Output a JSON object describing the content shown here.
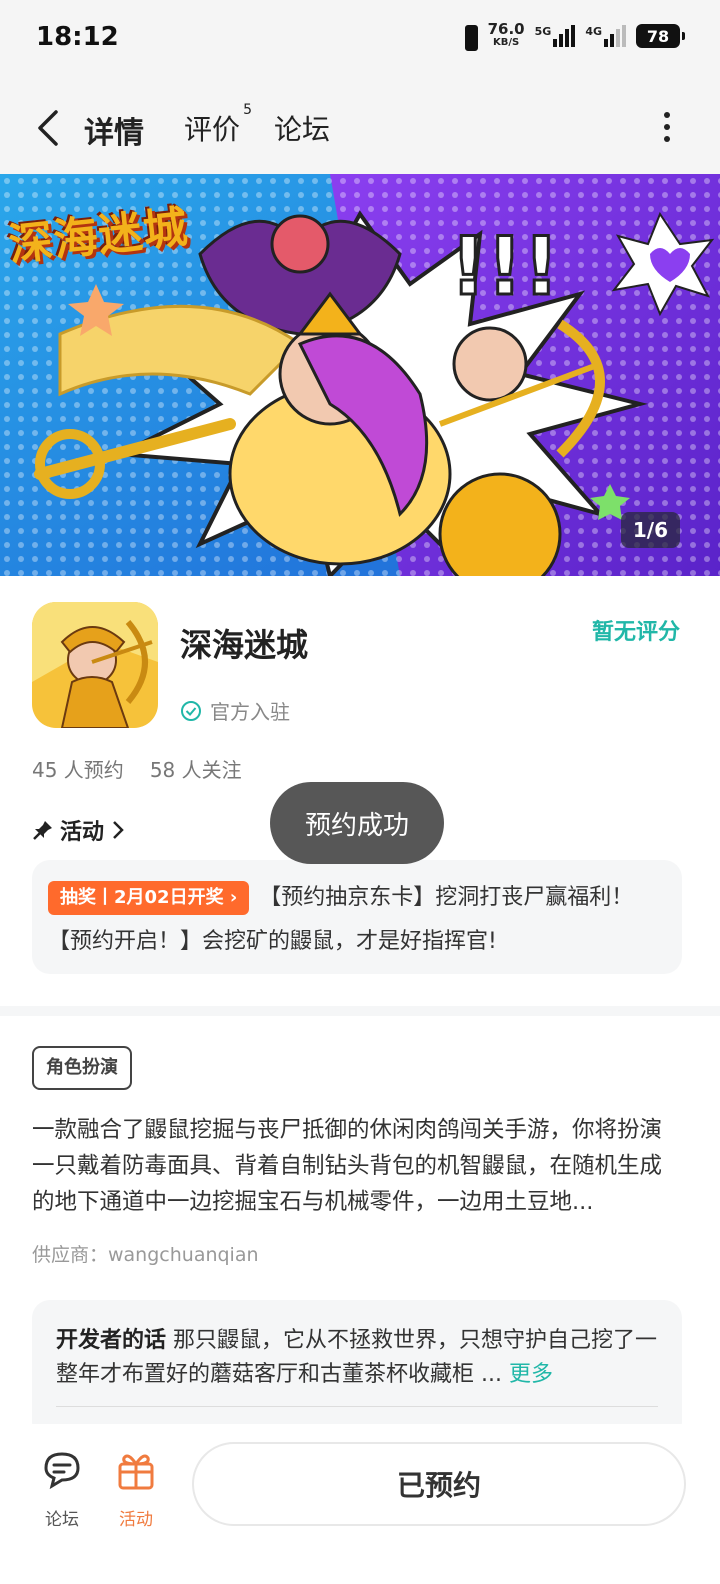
{
  "status_bar": {
    "time": "18:12",
    "speed_value": "76.0",
    "speed_unit": "KB/S",
    "net1": "5G",
    "net2": "4G",
    "battery": "78"
  },
  "nav": {
    "tabs": [
      {
        "label": "详情"
      },
      {
        "label": "评价",
        "badge": "5"
      },
      {
        "label": "论坛"
      }
    ]
  },
  "banner": {
    "title_art": "深海迷城",
    "counter": "1/6"
  },
  "app": {
    "name": "深海迷城",
    "rating": "暂无评分",
    "official": "官方入驻",
    "reservations": "45 人预约",
    "followers": "58 人关注"
  },
  "activity": {
    "heading": "活动",
    "badge": "抽奖丨2月02日开奖",
    "text": "【预约抽京东卡】挖洞打丧尸赢福利！【预约开启！】会挖矿的鼹鼠，才是好指挥官!"
  },
  "toast": "预约成功",
  "details": {
    "genre": "角色扮演",
    "description": "一款融合了鼹鼠挖掘与丧尸抵御的休闲肉鸽闯关手游，你将扮演一只戴着防毒面具、背着自制钻头背包的机智鼹鼠，在随机生成的地下通道中一边挖掘宝石与机械零件，一边用土豆地...",
    "supplier": "供应商：wangchuanqian"
  },
  "developer": {
    "label": "开发者的话",
    "text": "那只鼹鼠，它从不拯救世界，只想守护自己挖了一整年才布置好的蘑菇客厅和古董茶杯收藏柜 ...",
    "more": "更多"
  },
  "bottom_bar": {
    "forum": "论坛",
    "activity": "活动",
    "reserved": "已预约"
  },
  "colors": {
    "accent": "#21b7a8",
    "orange": "#ff6a2c",
    "toast_bg": "#575757"
  }
}
